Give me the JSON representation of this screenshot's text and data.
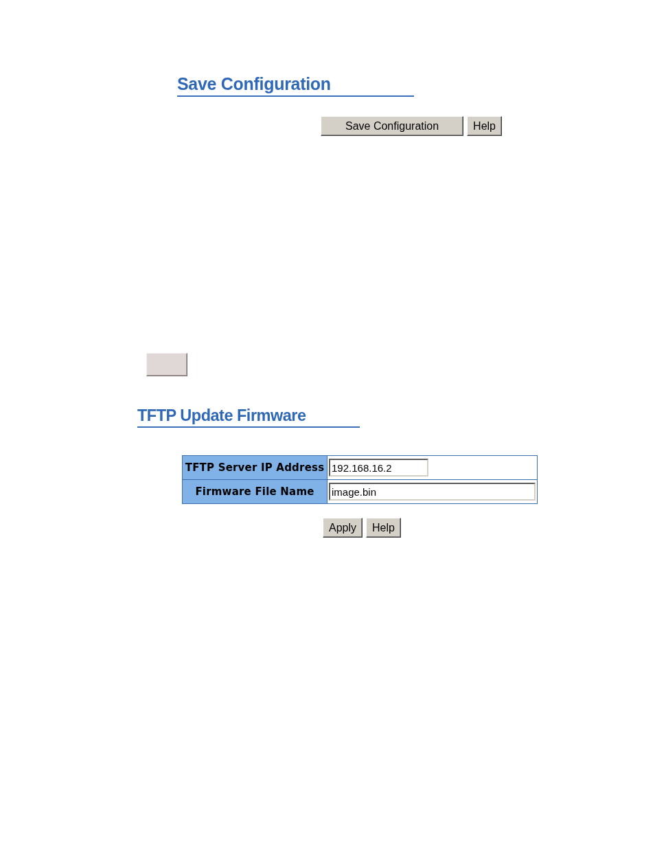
{
  "save_configuration": {
    "title": "Save Configuration",
    "buttons": [
      {
        "label": "Save Configuration"
      },
      {
        "label": "Help"
      }
    ]
  },
  "tftp_update_firmware": {
    "title": "TFTP Update Firmware",
    "fields": [
      {
        "label": "TFTP Server IP Address",
        "value": "192.168.16.2",
        "kind": "short"
      },
      {
        "label": "Firmware File Name",
        "value": "image.bin",
        "kind": "long"
      }
    ],
    "buttons": [
      {
        "label": "Apply"
      },
      {
        "label": "Help"
      }
    ]
  }
}
